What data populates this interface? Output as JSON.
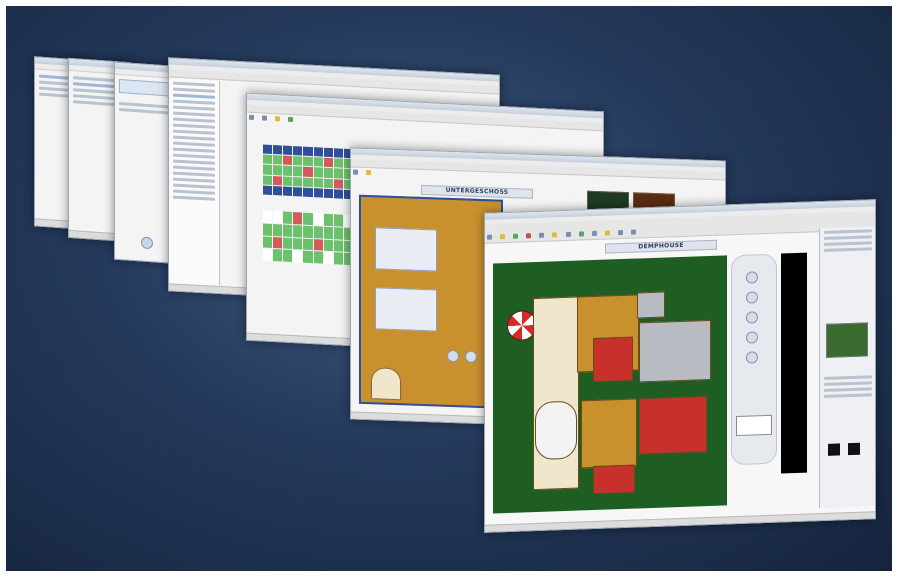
{
  "scene": {
    "description_visible": false
  },
  "windows": [
    {
      "id": "win-1",
      "kind": "explorer"
    },
    {
      "id": "win-2",
      "kind": "explorer"
    },
    {
      "id": "win-3",
      "kind": "form"
    },
    {
      "id": "win-4",
      "kind": "tree-editor"
    },
    {
      "id": "win-5",
      "kind": "grid-monitor"
    },
    {
      "id": "win-6",
      "kind": "building-control"
    },
    {
      "id": "win-7",
      "kind": "floorplan-editor"
    }
  ],
  "front_window": {
    "plan_label": "DEMPHOUSE",
    "accent_colors": {
      "grass": "#1f5e22",
      "wood": "#c9912e",
      "carpet": "#c8302c",
      "umbrella": "#d52a2a"
    }
  },
  "middle_window": {
    "label": "UNTERGESCHOSS",
    "accent_colors": {
      "wood": "#c9912e",
      "blue": "#2f4f9a"
    }
  },
  "grid_window": {
    "accent_colors": {
      "ok": "#6cc26c",
      "header": "#2f4f9a",
      "alarm": "#d35a5a"
    }
  },
  "icons": [
    "toolbar-button-icon",
    "umbrella-icon",
    "device-icon",
    "thumbnail-icon"
  ]
}
